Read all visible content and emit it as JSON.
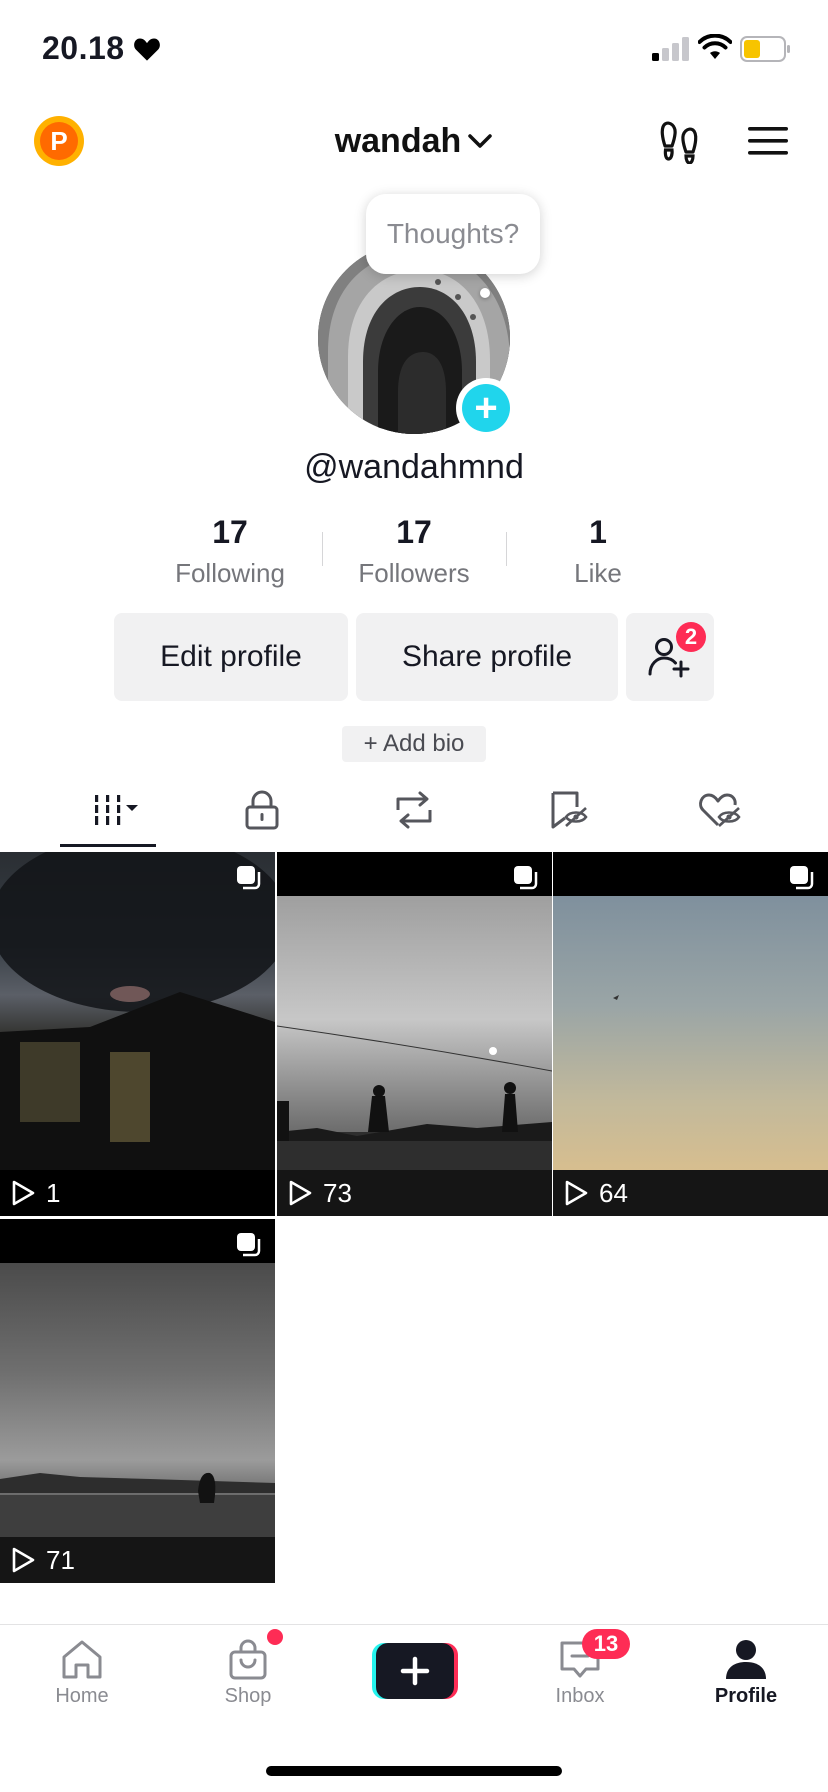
{
  "status_bar": {
    "time": "20.18"
  },
  "header": {
    "coin_letter": "P",
    "username_title": "wandah"
  },
  "profile": {
    "bubble_text": "Thoughts?",
    "handle": "@wandahmnd",
    "stats": [
      {
        "value": "17",
        "label": "Following"
      },
      {
        "value": "17",
        "label": "Followers"
      },
      {
        "value": "1",
        "label": "Like"
      }
    ],
    "edit_label": "Edit profile",
    "share_label": "Share profile",
    "friends_badge": "2",
    "add_bio": "+ Add bio"
  },
  "tabs": [
    "videos-icon",
    "lock-icon",
    "repost-icon",
    "favorites-icon",
    "liked-icon"
  ],
  "videos": [
    {
      "views": "1"
    },
    {
      "views": "73"
    },
    {
      "views": "64"
    },
    {
      "views": "71"
    }
  ],
  "nav": {
    "home": "Home",
    "shop": "Shop",
    "inbox": "Inbox",
    "inbox_badge": "13",
    "profile": "Profile"
  },
  "colors": {
    "accent_red": "#fe2c55",
    "accent_cyan": "#20d5ec",
    "text": "#161823"
  }
}
